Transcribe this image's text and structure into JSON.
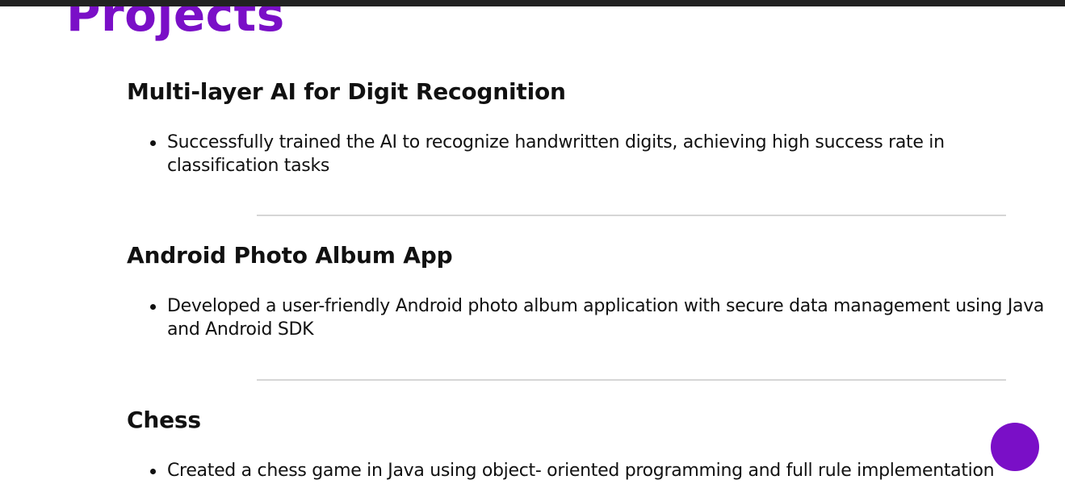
{
  "section": {
    "title": "Projects"
  },
  "projects": [
    {
      "title": "Multi-layer AI for Digit Recognition",
      "bullets": [
        "Successfully trained the AI to recognize handwritten digits, achieving high success rate in classification tasks"
      ]
    },
    {
      "title": "Android Photo Album App",
      "bullets": [
        "Developed a user-friendly Android photo album application with secure data management using Java and Android SDK"
      ]
    },
    {
      "title": "Chess",
      "bullets": [
        "Created a chess game in Java using object- oriented programming and full rule implementation"
      ]
    }
  ],
  "colors": {
    "accent": "#7a0fc7",
    "top_bar": "#222222",
    "divider": "#d6d6d6",
    "text": "#111111"
  }
}
